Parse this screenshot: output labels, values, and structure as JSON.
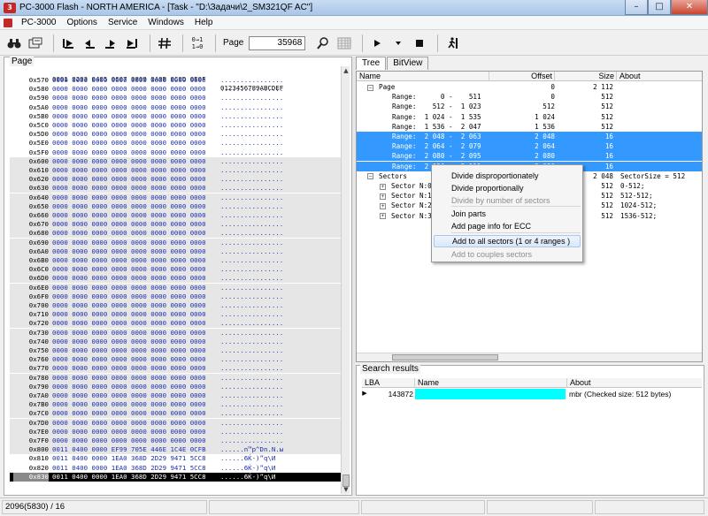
{
  "window": {
    "title": "PC-3000 Flash  - NORTH AMERICA - [Task - \"D:\\Задачи\\2_SM321QF AC\"]",
    "minimize": "–",
    "maximize": "□",
    "close": "✕",
    "app_icon_text": "3"
  },
  "menu": {
    "items": [
      "PC-3000",
      "Options",
      "Service",
      "Windows",
      "Help"
    ]
  },
  "toolbar": {
    "page_label": "Page",
    "page_value": "35968",
    "icons": [
      "binoculars-icon",
      "open-icon",
      "first-icon",
      "prev-icon",
      "next-icon",
      "last-icon",
      "hash-icon",
      "swap-icon",
      "zoom-icon",
      "grid-icon",
      "play-icon",
      "dropdown-icon",
      "stop-icon",
      "run-icon"
    ],
    "swap_text": "0→1 1→0"
  },
  "hex_panel": {
    "caption": "Page",
    "header_bytes": "0001 0203 0405 0607 0809 0A0B 0C0D 0E0F",
    "header_ascii": "0123456789ABCDEF",
    "rows": [
      {
        "off": "0x570",
        "bytes": "0000 0000 0000 0000 0000 0000 0000 0000",
        "ascii": "................"
      },
      {
        "off": "0x580",
        "bytes": "0000 0000 0000 0000 0000 0000 0000 0000",
        "ascii": "................"
      },
      {
        "off": "0x590",
        "bytes": "0000 0000 0000 0000 0000 0000 0000 0000",
        "ascii": "................"
      },
      {
        "off": "0x5A0",
        "bytes": "0000 0000 0000 0000 0000 0000 0000 0000",
        "ascii": "................"
      },
      {
        "off": "0x5B0",
        "bytes": "0000 0000 0000 0000 0000 0000 0000 0000",
        "ascii": "................"
      },
      {
        "off": "0x5C0",
        "bytes": "0000 0000 0000 0000 0000 0000 0000 0000",
        "ascii": "................"
      },
      {
        "off": "0x5D0",
        "bytes": "0000 0000 0000 0000 0000 0000 0000 0000",
        "ascii": "................"
      },
      {
        "off": "0x5E0",
        "bytes": "0000 0000 0000 0000 0000 0000 0000 0000",
        "ascii": "................"
      },
      {
        "off": "0x5F0",
        "bytes": "0000 0000 0000 0000 0000 0000 0000 0000",
        "ascii": "................"
      },
      {
        "off": "0x600",
        "bytes": "0000 0000 0000 0000 0000 0000 0000 0000",
        "ascii": "................"
      },
      {
        "off": "0x610",
        "bytes": "0000 0000 0000 0000 0000 0000 0000 0000",
        "ascii": "................"
      },
      {
        "off": "0x620",
        "bytes": "0000 0000 0000 0000 0000 0000 0000 0000",
        "ascii": "................"
      },
      {
        "off": "0x630",
        "bytes": "0000 0000 0000 0000 0000 0000 0000 0000",
        "ascii": "................"
      },
      {
        "off": "0x640",
        "bytes": "0000 0000 0000 0000 0000 0000 0000 0000",
        "ascii": "................"
      },
      {
        "off": "0x650",
        "bytes": "0000 0000 0000 0000 0000 0000 0000 0000",
        "ascii": "................"
      },
      {
        "off": "0x660",
        "bytes": "0000 0000 0000 0000 0000 0000 0000 0000",
        "ascii": "................"
      },
      {
        "off": "0x670",
        "bytes": "0000 0000 0000 0000 0000 0000 0000 0000",
        "ascii": "................"
      },
      {
        "off": "0x680",
        "bytes": "0000 0000 0000 0000 0000 0000 0000 0000",
        "ascii": "................"
      },
      {
        "off": "0x690",
        "bytes": "0000 0000 0000 0000 0000 0000 0000 0000",
        "ascii": "................"
      },
      {
        "off": "0x6A0",
        "bytes": "0000 0000 0000 0000 0000 0000 0000 0000",
        "ascii": "................"
      },
      {
        "off": "0x6B0",
        "bytes": "0000 0000 0000 0000 0000 0000 0000 0000",
        "ascii": "................"
      },
      {
        "off": "0x6C0",
        "bytes": "0000 0000 0000 0000 0000 0000 0000 0000",
        "ascii": "................"
      },
      {
        "off": "0x6D0",
        "bytes": "0000 0000 0000 0000 0000 0000 0000 0000",
        "ascii": "................"
      },
      {
        "off": "0x6E0",
        "bytes": "0000 0000 0000 0000 0000 0000 0000 0000",
        "ascii": "................"
      },
      {
        "off": "0x6F0",
        "bytes": "0000 0000 0000 0000 0000 0000 0000 0000",
        "ascii": "................"
      },
      {
        "off": "0x700",
        "bytes": "0000 0000 0000 0000 0000 0000 0000 0000",
        "ascii": "................"
      },
      {
        "off": "0x710",
        "bytes": "0000 0000 0000 0000 0000 0000 0000 0000",
        "ascii": "................"
      },
      {
        "off": "0x720",
        "bytes": "0000 0000 0000 0000 0000 0000 0000 0000",
        "ascii": "................"
      },
      {
        "off": "0x730",
        "bytes": "0000 0000 0000 0000 0000 0000 0000 0000",
        "ascii": "................"
      },
      {
        "off": "0x740",
        "bytes": "0000 0000 0000 0000 0000 0000 0000 0000",
        "ascii": "................"
      },
      {
        "off": "0x750",
        "bytes": "0000 0000 0000 0000 0000 0000 0000 0000",
        "ascii": "................"
      },
      {
        "off": "0x760",
        "bytes": "0000 0000 0000 0000 0000 0000 0000 0000",
        "ascii": "................"
      },
      {
        "off": "0x770",
        "bytes": "0000 0000 0000 0000 0000 0000 0000 0000",
        "ascii": "................"
      },
      {
        "off": "0x780",
        "bytes": "0000 0000 0000 0000 0000 0000 0000 0000",
        "ascii": "................"
      },
      {
        "off": "0x790",
        "bytes": "0000 0000 0000 0000 0000 0000 0000 0000",
        "ascii": "................"
      },
      {
        "off": "0x7A0",
        "bytes": "0000 0000 0000 0000 0000 0000 0000 0000",
        "ascii": "................"
      },
      {
        "off": "0x7B0",
        "bytes": "0000 0000 0000 0000 0000 0000 0000 0000",
        "ascii": "................"
      },
      {
        "off": "0x7C0",
        "bytes": "0000 0000 0000 0000 0000 0000 0000 0000",
        "ascii": "................"
      },
      {
        "off": "0x7D0",
        "bytes": "0000 0000 0000 0000 0000 0000 0000 0000",
        "ascii": "................"
      },
      {
        "off": "0x7E0",
        "bytes": "0000 0000 0000 0000 0000 0000 0000 0000",
        "ascii": "................"
      },
      {
        "off": "0x7F0",
        "bytes": "0000 0000 0000 0000 0000 0000 0000 0000",
        "ascii": "................"
      },
      {
        "off": "0x800",
        "bytes": "0011 0400 0000 EF99 705E 446E 1C4E 0CFB",
        "ascii": "......n™p^Dn.N.ы"
      },
      {
        "off": "0x810",
        "bytes": "0011 0400 0000 1EA0 368D 2D29 9471 5CC8",
        "ascii": "......6Ќ-)”q\\И"
      },
      {
        "off": "0x820",
        "bytes": "0011 0400 0000 1EA0 368D 2D29 9471 5CC8",
        "ascii": "......6Ќ-)”q\\И"
      },
      {
        "off": "0x830",
        "bytes": "0011 0400 0000 1EA0 368D 2D29 9471 5CC8",
        "ascii": "......6Ќ-)”q\\И"
      }
    ]
  },
  "tree_panel": {
    "tabs": [
      "Tree",
      "BitView"
    ],
    "columns": [
      "Name",
      "Offset",
      "Size",
      "About"
    ],
    "rows": [
      {
        "name": "Page",
        "offset": "0",
        "size": "2 112",
        "about": "",
        "indent": 1,
        "expander": "−",
        "hl": false
      },
      {
        "name": "Range:      0 -    511",
        "offset": "0",
        "size": "512",
        "about": "",
        "indent": 2,
        "expander": "",
        "hl": false
      },
      {
        "name": "Range:    512 -  1 023",
        "offset": "512",
        "size": "512",
        "about": "",
        "indent": 2,
        "expander": "",
        "hl": false
      },
      {
        "name": "Range:  1 024 -  1 535",
        "offset": "1 024",
        "size": "512",
        "about": "",
        "indent": 2,
        "expander": "",
        "hl": false
      },
      {
        "name": "Range:  1 536 -  2 047",
        "offset": "1 536",
        "size": "512",
        "about": "",
        "indent": 2,
        "expander": "",
        "hl": false
      },
      {
        "name": "Range:  2 048 -  2 063",
        "offset": "2 048",
        "size": "16",
        "about": "",
        "indent": 2,
        "expander": "",
        "hl": true
      },
      {
        "name": "Range:  2 064 -  2 079",
        "offset": "2 064",
        "size": "16",
        "about": "",
        "indent": 2,
        "expander": "",
        "hl": true
      },
      {
        "name": "Range:  2 080 -  2 095",
        "offset": "2 080",
        "size": "16",
        "about": "",
        "indent": 2,
        "expander": "",
        "hl": true
      },
      {
        "name": "Range:  2 096 -  2 111",
        "offset": "2 096",
        "size": "16",
        "about": "",
        "indent": 2,
        "expander": "",
        "hl": true
      },
      {
        "name": "Sectors",
        "offset": "",
        "size": "2 048",
        "about": "SectorSize = 512",
        "indent": 1,
        "expander": "−",
        "hl": false
      },
      {
        "name": "Sector N:0",
        "offset": "",
        "size": "512",
        "about": "0-512;",
        "indent": 2,
        "expander": "+",
        "hl": false
      },
      {
        "name": "Sector N:1",
        "offset": "",
        "size": "512",
        "about": "512-512;",
        "indent": 2,
        "expander": "+",
        "hl": false
      },
      {
        "name": "Sector N:2",
        "offset": "",
        "size": "512",
        "about": "1024-512;",
        "indent": 2,
        "expander": "+",
        "hl": false
      },
      {
        "name": "Sector N:3",
        "offset": "",
        "size": "512",
        "about": "1536-512;",
        "indent": 2,
        "expander": "+",
        "hl": false
      }
    ]
  },
  "context_menu": {
    "items": [
      {
        "label": "Divide disproportionately",
        "disabled": false,
        "hover": false
      },
      {
        "label": "Divide proportionally",
        "disabled": false,
        "hover": false
      },
      {
        "label": "Divide by  number of sectors",
        "disabled": true,
        "hover": false
      },
      {
        "label": "Join parts",
        "disabled": false,
        "hover": false
      },
      {
        "label": "Add page info for ECC",
        "disabled": false,
        "hover": false
      },
      {
        "label": "Add to all sectors (1 or 4 ranges )",
        "disabled": false,
        "hover": true
      },
      {
        "label": "Add to couples sectors",
        "disabled": true,
        "hover": false
      }
    ]
  },
  "search_results": {
    "caption": "Search results",
    "columns": [
      "LBA",
      "Name",
      "About"
    ],
    "rows": [
      {
        "indicator": "▶",
        "lba": "143872",
        "name": "",
        "about": "mbr (Checked size: 512 bytes)"
      }
    ],
    "name_cell_color": "#00ffff"
  },
  "status_bar": {
    "position": "2096(5830) / 16",
    "cells": [
      "",
      "",
      "",
      ""
    ]
  },
  "colors": {
    "selection_blue": "#3399ff",
    "hex_blue": "#1c2fae"
  }
}
